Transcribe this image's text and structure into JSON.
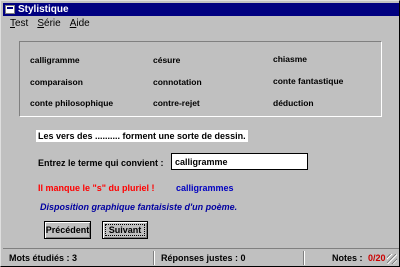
{
  "window": {
    "title": "Stylistique"
  },
  "menu": [
    {
      "underline": "T",
      "rest": "est"
    },
    {
      "underline": "S",
      "rest": "érie"
    },
    {
      "underline": "A",
      "rest": "ide"
    }
  ],
  "terms": [
    "calligramme",
    "césure",
    "chiasme",
    "comparaison",
    "connotation",
    "conte fantastique",
    "conte philosophique",
    "contre-rejet",
    "déduction"
  ],
  "exercise": {
    "sentence": "Les vers des ..........  forment une sorte de dessin.",
    "prompt_label": "Entrez le terme qui convient :",
    "answer_value": "calligramme",
    "feedback_error": "Il manque le \"s\" du pluriel !",
    "feedback_correct": "calligrammes",
    "definition": "Disposition graphique fantaisiste d'un poème."
  },
  "buttons": {
    "previous": "Précédent",
    "next": "Suivant"
  },
  "status": {
    "studied_label": "Mots étudiés : 3",
    "correct_label": "Réponses justes : 0",
    "notes_label": "Notes :",
    "notes_value": "0/20"
  }
}
